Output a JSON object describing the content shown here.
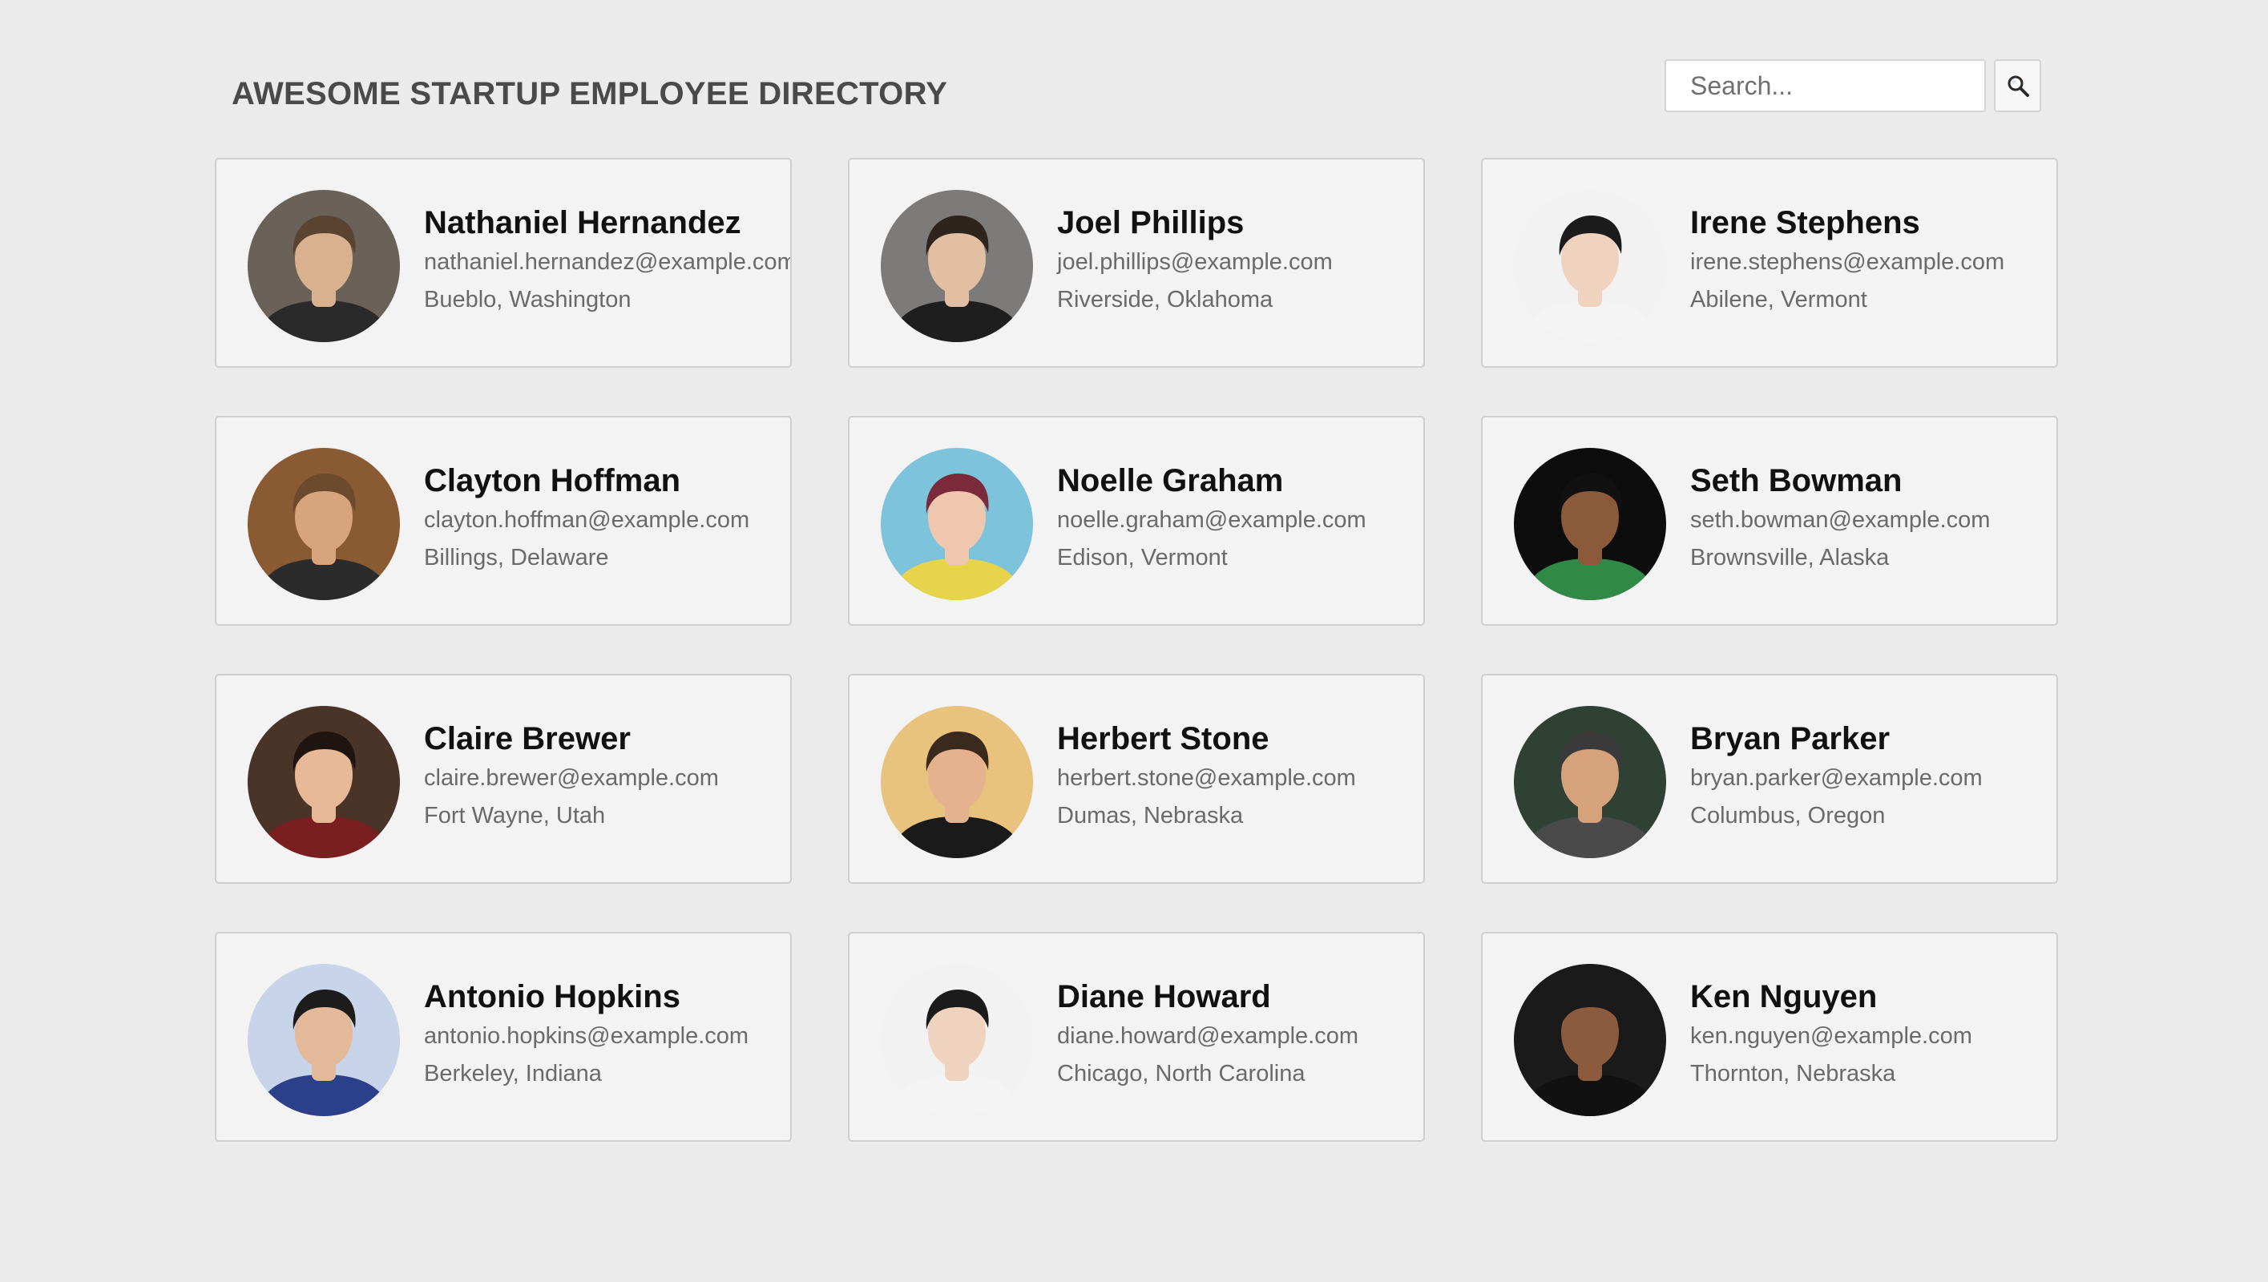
{
  "header": {
    "title": "AWESOME STARTUP EMPLOYEE DIRECTORY"
  },
  "search": {
    "placeholder": "Search...",
    "icon": "magnifier-icon"
  },
  "employees": [
    {
      "name": "Nathaniel Hernandez",
      "email": "nathaniel.hernandez@example.com",
      "location": "Bueblo, Washington",
      "photo": {
        "bg": "#6a6258",
        "skin": "#d9b18e",
        "hair": "#5a4330",
        "shirt": "#2a2a2a"
      }
    },
    {
      "name": "Joel Phillips",
      "email": "joel.phillips@example.com",
      "location": "Riverside, Oklahoma",
      "photo": {
        "bg": "#7d7b79",
        "skin": "#e2bfa3",
        "hair": "#2e241d",
        "shirt": "#1e1e1e"
      }
    },
    {
      "name": "Irene Stephens",
      "email": "irene.stephens@example.com",
      "location": "Abilene, Vermont",
      "photo": {
        "bg": "#f2f2f2",
        "skin": "#f0d3bf",
        "hair": "#1b1b1b",
        "shirt": "#f4f4f4"
      }
    },
    {
      "name": "Clayton Hoffman",
      "email": "clayton.hoffman@example.com",
      "location": "Billings, Delaware",
      "photo": {
        "bg": "#8a5a32",
        "skin": "#d8a47c",
        "hair": "#6b4a2e",
        "shirt": "#2b2b2b"
      }
    },
    {
      "name": "Noelle Graham",
      "email": "noelle.graham@example.com",
      "location": "Edison, Vermont",
      "photo": {
        "bg": "#7ec3dc",
        "skin": "#efc7ae",
        "hair": "#7a2a3a",
        "shirt": "#e8d44a"
      }
    },
    {
      "name": "Seth Bowman",
      "email": "seth.bowman@example.com",
      "location": "Brownsville, Alaska",
      "photo": {
        "bg": "#0d0d0d",
        "skin": "#8a5a3a",
        "hair": "#111111",
        "shirt": "#2f8a46"
      }
    },
    {
      "name": "Claire Brewer",
      "email": "claire.brewer@example.com",
      "location": "Fort Wayne, Utah",
      "photo": {
        "bg": "#4a3428",
        "skin": "#e8b997",
        "hair": "#1f1410",
        "shirt": "#7a1f1f"
      }
    },
    {
      "name": "Herbert Stone",
      "email": "herbert.stone@example.com",
      "location": "Dumas, Nebraska",
      "photo": {
        "bg": "#e9c27e",
        "skin": "#e5b18e",
        "hair": "#3a2a1e",
        "shirt": "#1a1a1a"
      }
    },
    {
      "name": "Bryan Parker",
      "email": "bryan.parker@example.com",
      "location": "Columbus, Oregon",
      "photo": {
        "bg": "#2e4134",
        "skin": "#d6a27c",
        "hair": "#3a3a3a",
        "shirt": "#4a4a4a"
      }
    },
    {
      "name": "Antonio Hopkins",
      "email": "antonio.hopkins@example.com",
      "location": "Berkeley, Indiana",
      "photo": {
        "bg": "#c8d4ea",
        "skin": "#e3b99a",
        "hair": "#1c1c1c",
        "shirt": "#2c3f8a"
      }
    },
    {
      "name": "Diane Howard",
      "email": "diane.howard@example.com",
      "location": "Chicago, North Carolina",
      "photo": {
        "bg": "#f2f2f2",
        "skin": "#f0d3bf",
        "hair": "#1b1b1b",
        "shirt": "#f4f4f4"
      }
    },
    {
      "name": "Ken Nguyen",
      "email": "ken.nguyen@example.com",
      "location": "Thornton, Nebraska",
      "photo": {
        "bg": "#1a1a1a",
        "skin": "#8c5a3c",
        "hair": "#1a1a1a",
        "shirt": "#111111"
      }
    }
  ]
}
